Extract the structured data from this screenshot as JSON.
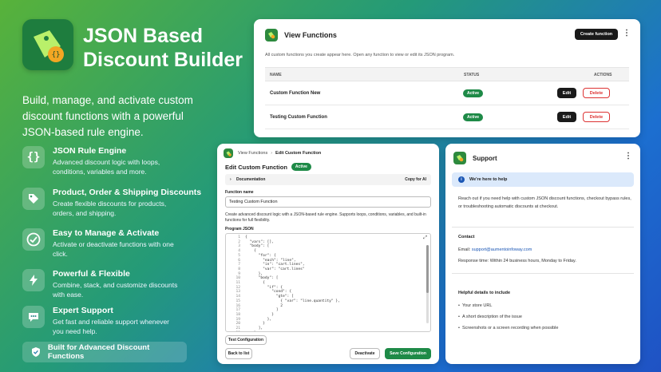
{
  "hero": {
    "title_line1": "JSON Based",
    "title_line2": "Discount Builder",
    "tagline": "Build, manage, and activate custom discount functions with a powerful JSON-based rule engine."
  },
  "features": [
    {
      "title": "JSON Rule Engine",
      "desc": "Advanced discount logic with loops, conditions, variables and more.",
      "icon": "braces-icon"
    },
    {
      "title": "Product, Order & Shipping Discounts",
      "desc": "Create flexible discounts for products, orders, and shipping.",
      "icon": "tag-icon"
    },
    {
      "title": "Easy to Manage & Activate",
      "desc": "Activate or deactivate functions with one click.",
      "icon": "check-circle-icon"
    },
    {
      "title": "Powerful & Flexible",
      "desc": "Combine, stack, and customize discounts with ease.",
      "icon": "lightning-icon"
    },
    {
      "title": "Expert Support",
      "desc": "Get fast and reliable support whenever you need help.",
      "icon": "chat-icon"
    }
  ],
  "bottom_badge": "Built for Advanced Discount Functions",
  "view_functions": {
    "title": "View Functions",
    "create_label": "Create function",
    "description": "All custom functions you create appear here. Open any function to view or edit its JSON program.",
    "columns": {
      "name": "NAME",
      "status": "STATUS",
      "actions": "ACTIONS"
    },
    "rows": [
      {
        "name": "Custom Function New",
        "status": "Active",
        "edit": "Edit",
        "delete": "Delete"
      },
      {
        "name": "Testing Custom Function",
        "status": "Active",
        "edit": "Edit",
        "delete": "Delete"
      }
    ]
  },
  "edit_function": {
    "breadcrumb_parent": "View Functions",
    "breadcrumb_current": "Edit Custom Function",
    "heading": "Edit Custom Function",
    "status": "Active",
    "documentation": "Documentation",
    "copy_for_ai": "Copy for AI",
    "function_name_label": "Function name",
    "function_name_value": "Testing Custom Function",
    "help_text": "Create advanced discount logic with a JSON-based rule engine. Supports loops, conditions, variables, and built-in functions for full flexibility.",
    "program_label": "Program JSON",
    "test_label": "Test Configuration",
    "back_label": "Back to list",
    "deactivate_label": "Deactivate",
    "save_label": "Save Configuration"
  },
  "code_lines": [
    "{",
    "  \"vars\": [],",
    "  \"body\": [",
    "    {",
    "      \"for\": {",
    "        \"each\": \"line\",",
    "        \"in\": \"cart.lines\",",
    "        \"var\": \"cart.lines\"",
    "      },",
    "      \"body\": [",
    "        {",
    "          \"if\": {",
    "            \"cond\": {",
    "              \"gte\": [",
    "                { \"var\": \"line.quantity\" },",
    "                2",
    "              ]",
    "            }",
    "          },",
    "        }",
    "      ],",
    "    }"
  ],
  "support": {
    "title": "Support",
    "banner": "We're here to help",
    "intro": "Reach out if you need help with custom JSON discount functions, checkout bypass rules, or troubleshooting automatic discounts at checkout.",
    "contact_heading": "Contact",
    "email_label": "Email:",
    "email": "support@aumentoinfoway.com",
    "response_time": "Response time: Within 24 business hours, Monday to Friday.",
    "details_heading": "Helpful details to include",
    "details": [
      "Your store URL",
      "A short description of the issue",
      "Screenshots or a screen recording when possible"
    ]
  }
}
